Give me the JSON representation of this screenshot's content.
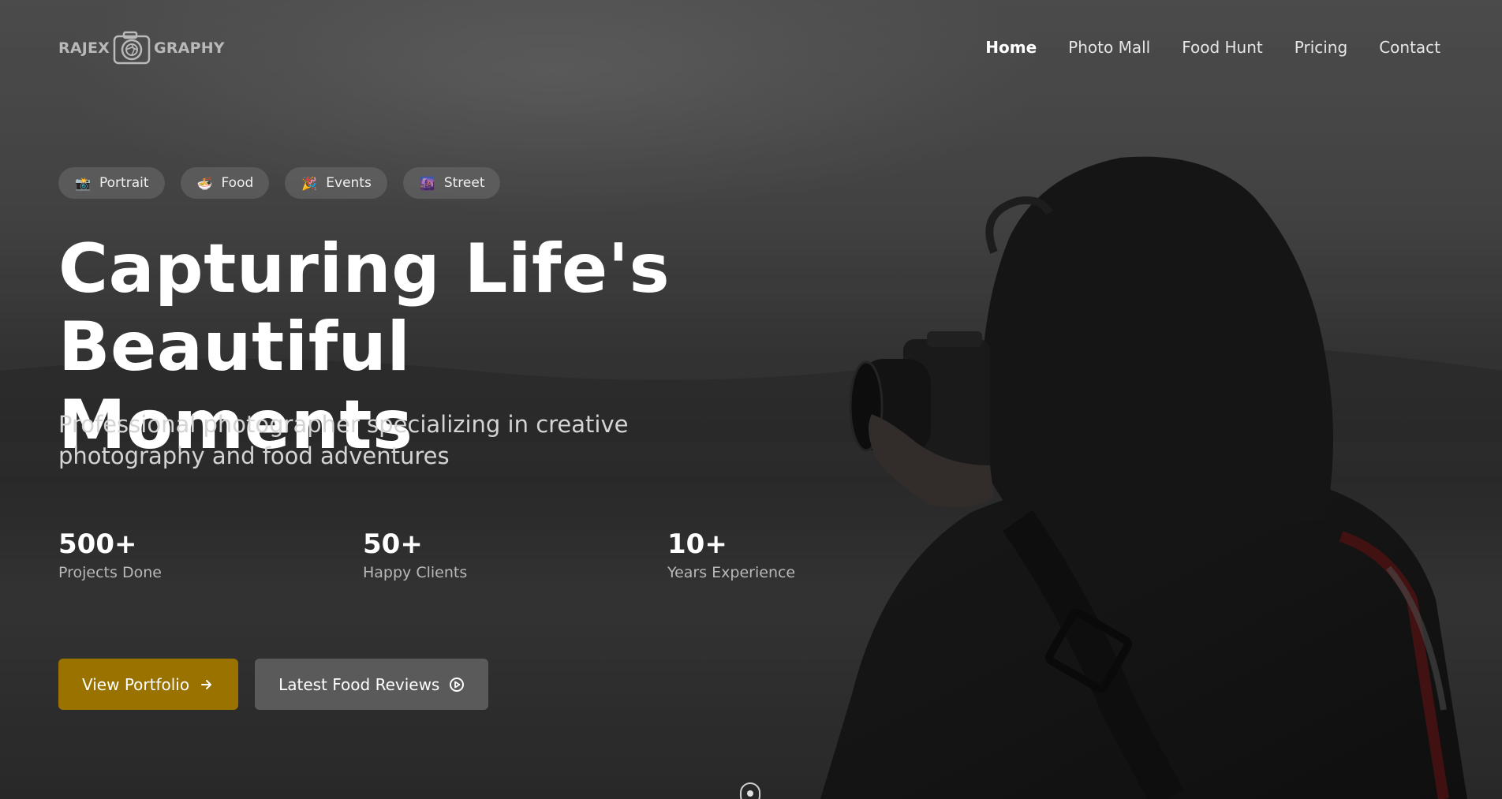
{
  "brand": {
    "logo_text_left": "RAJEX",
    "logo_text_right": "GRAPHY",
    "logo_icon": "camera-aperture-icon"
  },
  "nav": {
    "items": [
      {
        "label": "Home",
        "active": true
      },
      {
        "label": "Photo Mall",
        "active": false
      },
      {
        "label": "Food Hunt",
        "active": false
      },
      {
        "label": "Pricing",
        "active": false
      },
      {
        "label": "Contact",
        "active": false
      }
    ]
  },
  "tags": [
    {
      "emoji": "📸",
      "label": "Portrait"
    },
    {
      "emoji": "🍜",
      "label": "Food"
    },
    {
      "emoji": "🎉",
      "label": "Events"
    },
    {
      "emoji": "🌆",
      "label": "Street"
    }
  ],
  "hero": {
    "headline_line1": "Capturing Life's Beautiful",
    "headline_line2": "Moments",
    "subtitle_line1": "Professional photographer specializing in creative",
    "subtitle_line2": "photography and food adventures"
  },
  "stats": [
    {
      "value": "500+",
      "label": "Projects Done"
    },
    {
      "value": "50+",
      "label": "Happy Clients"
    },
    {
      "value": "10+",
      "label": "Years Experience"
    }
  ],
  "actions": {
    "primary_label": "View Portfolio",
    "primary_icon": "arrow-right-icon",
    "secondary_label": "Latest Food Reviews",
    "secondary_icon": "play-circle-icon"
  },
  "colors": {
    "accent": "#9a7200",
    "secondary_button": "#5f5f5f",
    "text_primary": "#ffffff",
    "text_muted": "#b8b8b8"
  }
}
